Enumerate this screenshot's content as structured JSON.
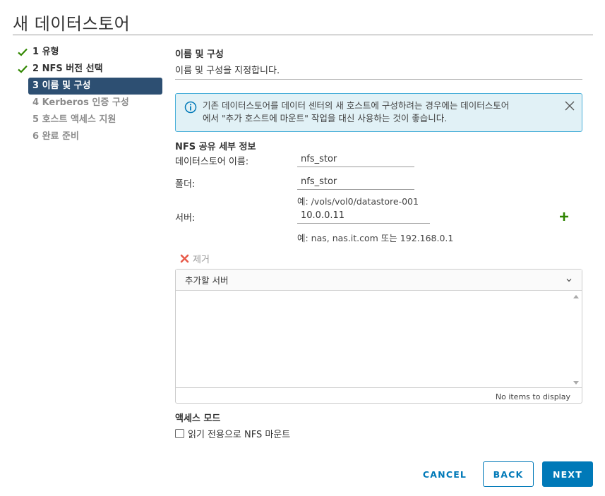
{
  "title": "새 데이터스토어",
  "steps": [
    {
      "label": "1 유형",
      "state": "done"
    },
    {
      "label": "2 NFS 버전 선택",
      "state": "done"
    },
    {
      "label": "3 이름 및 구성",
      "state": "active"
    },
    {
      "label": "4 Kerberos 인증 구성",
      "state": "todo"
    },
    {
      "label": "5 호스트 액세스 지원",
      "state": "todo"
    },
    {
      "label": "6 완료 준비",
      "state": "todo"
    }
  ],
  "section": {
    "title": "이름 및 구성",
    "description": "이름 및 구성을 지정합니다."
  },
  "alert": {
    "line1": "기존 데이터스토어를 데이터 센터의 새 호스트에 구성하려는 경우에는 데이터스토어",
    "line2": "에서 \"추가 호스트에 마운트\" 작업을 대신 사용하는 것이 좋습니다."
  },
  "nfs": {
    "title": "NFS 공유 세부 정보",
    "name_label": "데이터스토어 이름:",
    "name_value": "nfs_stor",
    "folder_label": "폴더:",
    "folder_value": "nfs_stor",
    "folder_hint": "예: /vols/vol0/datastore-001",
    "server_label": "서버:",
    "server_value": "10.0.0.11",
    "server_hint": "예: nas, nas.it.com 또는 192.168.0.1"
  },
  "remove_label": "제거",
  "grid": {
    "header": "추가할 서버",
    "footer": "No items to display"
  },
  "access": {
    "title": "액세스 모드",
    "checkbox_label": "읽기 전용으로 NFS 마운트"
  },
  "buttons": {
    "cancel": "CANCEL",
    "back": "BACK",
    "next": "NEXT"
  },
  "colors": {
    "accent": "#0079b8",
    "active_step": "#2d4f72",
    "check": "#318700",
    "add": "#2f8400",
    "remove": "#e12200"
  }
}
